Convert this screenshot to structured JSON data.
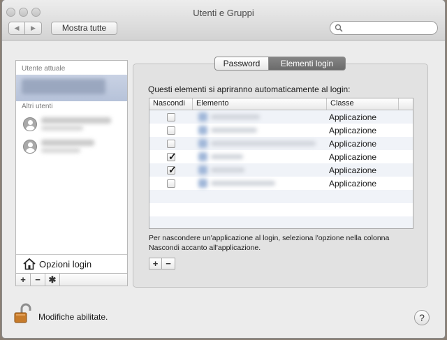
{
  "window": {
    "title": "Utenti e Gruppi"
  },
  "toolbar": {
    "back_icon": "chevron-left-icon",
    "forward_icon": "chevron-right-icon",
    "show_all": "Mostra tutte",
    "search_placeholder": ""
  },
  "sidebar": {
    "current_user_title": "Utente attuale",
    "other_users_title": "Altri utenti",
    "login_options": "Opzioni login",
    "add": "+",
    "remove": "−"
  },
  "tabs": [
    {
      "label": "Password",
      "selected": false
    },
    {
      "label": "Elementi login",
      "selected": true
    }
  ],
  "login_items": {
    "heading": "Questi elementi si apriranno automaticamente al login:",
    "columns": [
      "Nascondi",
      "Elemento",
      "Classe"
    ],
    "rows": [
      {
        "hide": false,
        "class": "Applicazione"
      },
      {
        "hide": false,
        "class": "Applicazione"
      },
      {
        "hide": false,
        "class": "Applicazione"
      },
      {
        "hide": true,
        "class": "Applicazione"
      },
      {
        "hide": true,
        "class": "Applicazione"
      },
      {
        "hide": false,
        "class": "Applicazione"
      }
    ],
    "note": "Per nascondere un'applicazione al login, seleziona l'opzione nella colonna Nascondi accanto all'applicazione.",
    "add": "+",
    "remove": "−"
  },
  "footer": {
    "lock_text": "Modifiche abilitate.",
    "help": "?"
  },
  "colors": {
    "selection": "#b6c2d9",
    "selected_tab": "#777777"
  }
}
